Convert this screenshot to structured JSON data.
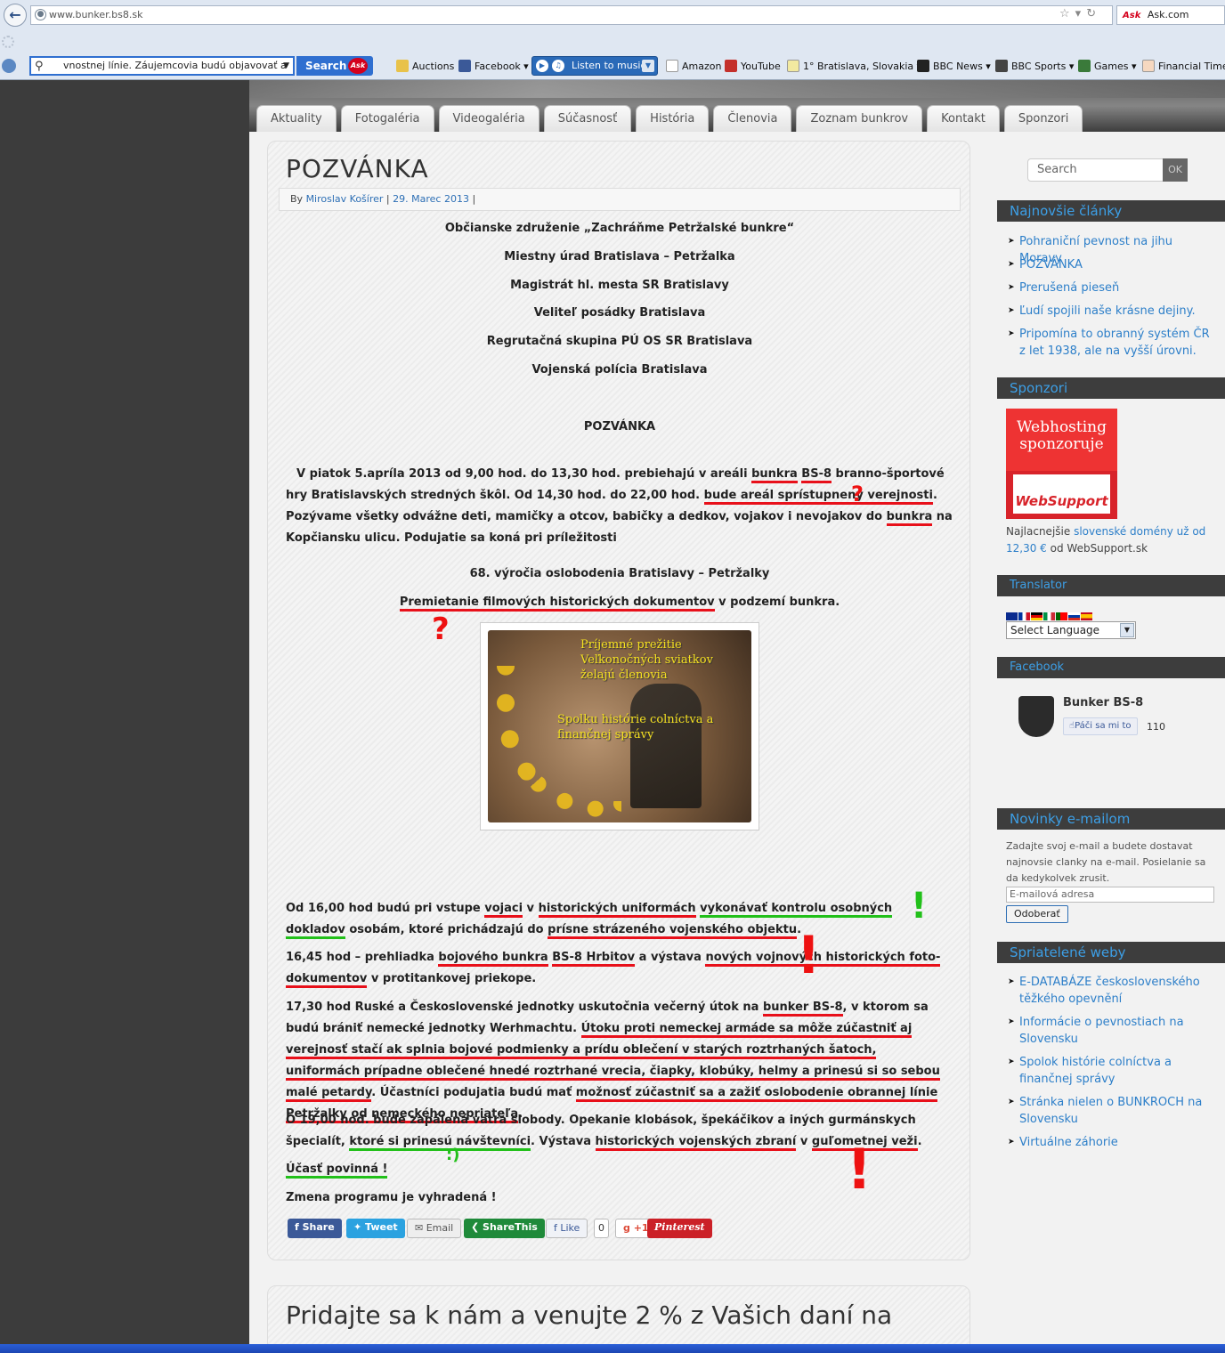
{
  "browser": {
    "url": "www.bunker.bs8.sk",
    "ask_label": "Ask.com",
    "search_value": "vnostnej línie. Záujemcovia budú objavovať a",
    "search_button": "Search",
    "listen_label": "Listen to music",
    "bookmarks": [
      "Auctions",
      "Facebook",
      "Amazon",
      "YouTube",
      "1° Bratislava, Slovakia",
      "BBC News",
      "BBC Sports",
      "Games",
      "Financial Times"
    ]
  },
  "nav": {
    "tabs": [
      "Aktuality",
      "Fotogaléria",
      "Videogaléria",
      "Súčasnosť",
      "História",
      "Členovia",
      "Zoznam bunkrov",
      "Kontakt",
      "Sponzori"
    ]
  },
  "article": {
    "title": "POZVÁNKA",
    "by": "By",
    "author": "Miroslav Košírer",
    "date": "29. Marec 2013",
    "sep": "|",
    "org_lines": [
      "Občianske združenie „Zachráňme Petržalské bunkre“",
      "Miestny úrad Bratislava – Petržalka",
      "Magistrát hl. mesta SR Bratislavy",
      "Veliteľ posádky Bratislava",
      "Regrutačná skupina PÚ OS SR Bratislava",
      "Vojenská polícia Bratislava"
    ],
    "heading": "POZVÁNKA",
    "p1": {
      "a": "V piatok 5.apríla 2013 od 9,00 hod. do 13,30 hod.  prebiehajú  v areáli ",
      "b": "bunkra",
      "c": " ",
      "d": "BS-8",
      "e": " branno-športové hry Bratislavských stredných škôl. Od 14,30 hod. do 22,00 hod. ",
      "f": "bude areál sprístupnený verejnosti",
      "g": ". Pozývame všetky odvážne deti, mamičky a otcov, babičky a dedkov, vojakov i nevojakov do ",
      "h": "bunkra",
      "i": " na Kopčiansku ulicu. Podujatie sa koná pri príležitosti"
    },
    "anniv": "68. výročia oslobodenia Bratislavy – Petržalky",
    "film": {
      "a": "Premietanie filmových historických dokumentov",
      "b": " v podzemí bunkra."
    },
    "easter_text1": "Príjemné prežitie Veľkonočných sviatkov želajú členovia",
    "easter_text2": "Spolku histórie colníctva a finančnej správy",
    "p2": {
      "a": "Od 16,00 hod  budú pri vstupe ",
      "b": "vojaci",
      "c": " v ",
      "d": "historických uniformách",
      "e": " ",
      "f": "vykonávať kontrolu osobných dokladov",
      "g": " osobám, ktoré prichádzajú do ",
      "h": "prísne strázeného vojenského objektu",
      "i": "."
    },
    "p3": {
      "a": "16,45 hod – prehliadka ",
      "b": "bojového bunkra",
      "c": " ",
      "d": "BS-8 Hrbitov",
      "e": " a výstava ",
      "f": "nových vojnových historických foto-dokumentov",
      "g": "  v protitankovej priekope."
    },
    "p4": {
      "a": "17,30  hod  Ruské  a Československé jednotky uskutočnia večerný útok na ",
      "b": "bunker BS-8",
      "c": ",  v ktorom  sa budú brániť nemecké jednotky Werhmachtu.  ",
      "d": "Útoku proti nemeckej armáde sa  môže  zúčastniť aj verejnosť stačí ak splnia bojové podmienky a prídu  oblečení v starých roztrhaných šatoch, uniformách prípadne oblečené hnedé roztrhané vrecia, čiapky, klobúky, helmy a prinesú si so sebou malé petardy",
      "e": ". Účastníci podujatia budú mať ",
      "f": "možnosť zúčastniť sa a zažiť oslobodenie obrannej línie Petržalky od nemeckého nepriateľa",
      "g": "."
    },
    "p5": {
      "a": "O 19,00 hod. bude zapálená vatra slobody. Opekanie klobások, špekáčikov a iných  gurmánskych špecialít, ",
      "b": "ktoré si prinesú návštevníci",
      "c": ". Výstava ",
      "d": "historických vojenských zbraní",
      "e": " v ",
      "f": "guľometnej veži",
      "g": "."
    },
    "mandatory": "Účasť povinná !",
    "change": "Zmena programu je vyhradená !",
    "share": {
      "fb": "Share",
      "tw": "Tweet",
      "email": "Email",
      "sharethis": "ShareThis",
      "like": "Like",
      "like_count": "0",
      "gplus": "+1",
      "pinterest": "Pinterest"
    },
    "marks": {
      "q1": "?",
      "q2": "?",
      "ex1": "!",
      "ex2": "!",
      "ex3": "!",
      "smile": ":)"
    }
  },
  "article2": {
    "title": "Pridajte sa k nám a venujte 2 % z Vašich daní na"
  },
  "sidebar": {
    "search_placeholder": "Search",
    "ok": "OK",
    "latest_title": "Najnovšie články",
    "latest": [
      "Pohraniční pevnost na jihu Moravy",
      "POZVÁNKA",
      "Prerušená pieseň",
      "Ľudí spojili naše krásne dejiny.",
      "Pripomína to obranný systém ČR z let 1938, ale na vyšší úrovni."
    ],
    "sponsors_title": "Sponzori",
    "ws_line1": "Webhosting",
    "ws_line2": "sponzoruje",
    "ws_brand": "WebSupport",
    "ws_a": "Najlacnejšie ",
    "ws_link": "slovenské domény už od 12,30 €",
    "ws_b": " od WebSupport.sk",
    "translator_title": "Translator",
    "select_language": "Select Language",
    "facebook_title": "Facebook",
    "fb_name": "Bunker BS-8",
    "fb_like": "Páči sa mi to",
    "fb_count": "110",
    "news_title": "Novinky e-mailom",
    "news_text": "Zadajte svoj e-mail a budete dostavat najnovsie clanky na e-mail. Posielanie sa da kedykolvek zrusit.",
    "email_placeholder": "E-mailová adresa",
    "subscribe": "Odoberať",
    "friends_title": "Spriatelené weby",
    "friends": [
      "E-DATABÁZE československého těžkého opevnění",
      "Informácie o pevnostiach na Slovensku",
      "Spolok histórie colníctva a finančnej správy",
      "Stránka nielen o BUNKROCH na Slovensku",
      "Virtuálne záhorie"
    ]
  }
}
